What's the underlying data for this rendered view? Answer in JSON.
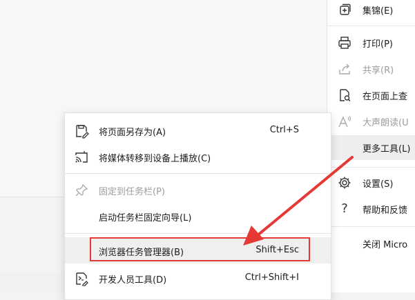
{
  "main_menu": {
    "items": [
      {
        "label": "集锦(E)",
        "icon": "collections-icon"
      },
      {
        "label": "打印(P)",
        "icon": "printer-icon"
      },
      {
        "label": "共享(R)",
        "icon": "share-icon",
        "disabled": true
      },
      {
        "label": "在页面上查",
        "icon": "find-on-page-icon"
      },
      {
        "label": "大声朗读(U",
        "icon": "read-aloud-icon",
        "disabled": true
      },
      {
        "label": "更多工具(L)",
        "icon": "",
        "highlighted": true
      },
      {
        "label": "设置(S)",
        "icon": "gear-icon"
      },
      {
        "label": "帮助和反馈",
        "icon": "help-icon"
      },
      {
        "label": "关闭 Micro",
        "icon": ""
      }
    ]
  },
  "sub_menu": {
    "items": [
      {
        "label": "将页面另存为(A)",
        "shortcut": "Ctrl+S",
        "icon": "save-page-icon"
      },
      {
        "label": "将媒体转移到设备上播放(C)",
        "shortcut": "",
        "icon": "cast-icon"
      },
      {
        "label": "固定到任务栏(P)",
        "shortcut": "",
        "icon": "pin-icon",
        "disabled": true
      },
      {
        "label": "启动任务栏固定向导(L)",
        "shortcut": "",
        "icon": ""
      },
      {
        "label": "浏览器任务管理器(B)",
        "shortcut": "Shift+Esc",
        "icon": "",
        "highlighted": true
      },
      {
        "label": "开发人员工具(D)",
        "shortcut": "Ctrl+Shift+I",
        "icon": "developer-tools-icon"
      }
    ]
  },
  "annotation": {
    "color": "#e53935"
  }
}
